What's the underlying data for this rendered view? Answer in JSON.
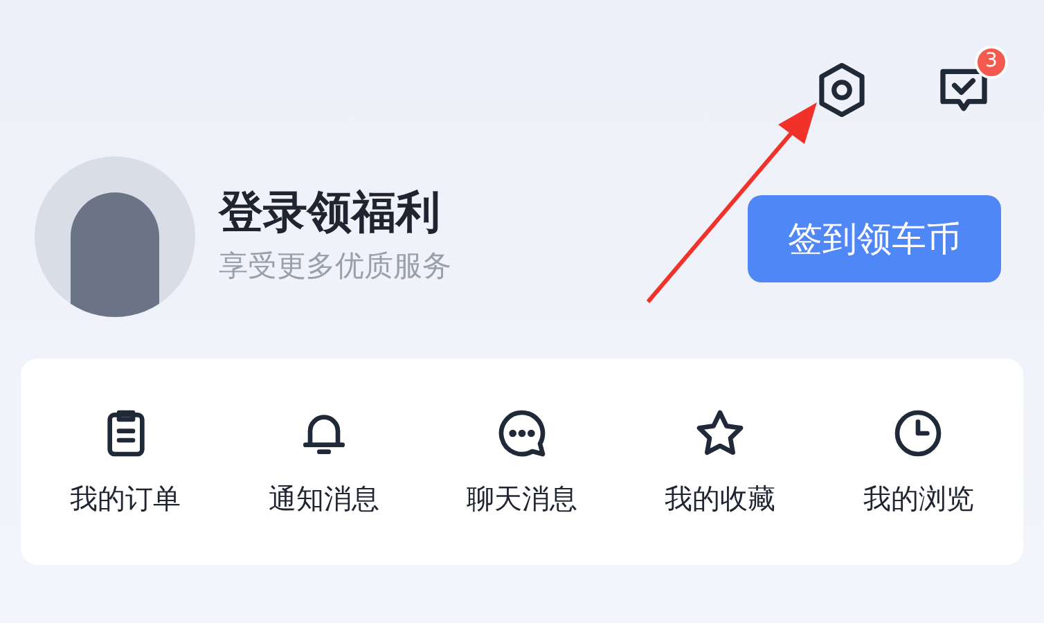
{
  "header": {
    "badge": "3"
  },
  "profile": {
    "title": "登录领福利",
    "subtitle": "享受更多优质服务",
    "button": "签到领车币"
  },
  "shortcuts": [
    {
      "kind": "orders",
      "label": "我的订单"
    },
    {
      "kind": "notify",
      "label": "通知消息"
    },
    {
      "kind": "chat",
      "label": "聊天消息"
    },
    {
      "kind": "favorites",
      "label": "我的收藏"
    },
    {
      "kind": "history",
      "label": "我的浏览"
    }
  ]
}
